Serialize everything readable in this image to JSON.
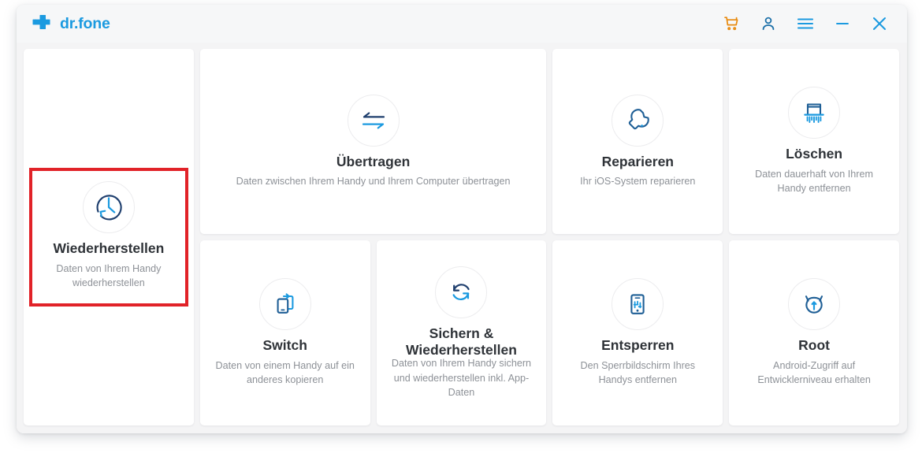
{
  "window": {
    "brand_name": "dr.fone",
    "brand_icon": "plus-cross-logo",
    "accent_blue": "#1b9ae0",
    "accent_orange": "#e8890c",
    "selection_red": "#e12228"
  },
  "titlebar": {
    "actions": [
      {
        "name": "cart-icon",
        "label": "Warenkorb"
      },
      {
        "name": "account-icon",
        "label": "Konto"
      },
      {
        "name": "menu-icon",
        "label": "Menü"
      },
      {
        "name": "minimize-icon",
        "label": "Minimieren"
      },
      {
        "name": "close-icon",
        "label": "Schließen"
      }
    ]
  },
  "cards": [
    {
      "id": "wiederherstellen",
      "icon": "clock-restore-icon",
      "title": "Wiederherstellen",
      "desc": "Daten von Ihrem Handy wiederherstellen",
      "selected": true
    },
    {
      "id": "uebertragen",
      "icon": "transfer-arrows-icon",
      "title": "Übertragen",
      "desc": "Daten zwischen Ihrem Handy und Ihrem Computer übertragen",
      "selected": false
    },
    {
      "id": "reparieren",
      "icon": "wrench-icon",
      "title": "Reparieren",
      "desc": "Ihr iOS-System reparieren",
      "selected": false
    },
    {
      "id": "loeschen",
      "icon": "shredder-icon",
      "title": "Löschen",
      "desc": "Daten dauerhaft von Ihrem Handy entfernen",
      "selected": false
    },
    {
      "id": "switch",
      "icon": "phone-switch-icon",
      "title": "Switch",
      "desc": "Daten von einem Handy auf ein anderes kopieren",
      "selected": false
    },
    {
      "id": "sichern-wiederherstellen",
      "icon": "sync-circle-icon",
      "title": "Sichern & Wiederherstellen",
      "desc": "Daten von Ihrem Handy sichern und wiederherstellen inkl. App-Daten",
      "selected": false
    },
    {
      "id": "entsperren",
      "icon": "phone-unlock-icon",
      "title": "Entsperren",
      "desc": "Den Sperrbildschirm Ihres Handys entfernen",
      "selected": false
    },
    {
      "id": "root",
      "icon": "android-root-icon",
      "title": "Root",
      "desc": "Android-Zugriff auf Entwicklerniveau erhalten",
      "selected": false
    }
  ]
}
